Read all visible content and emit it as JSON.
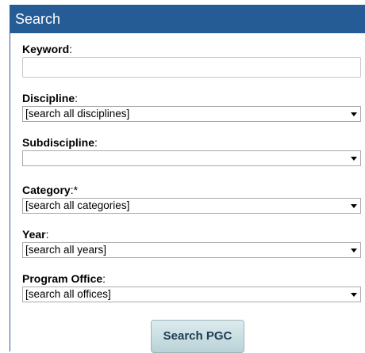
{
  "header": {
    "title": "Search"
  },
  "keyword": {
    "label": "Keyword",
    "colon": ":",
    "value": "",
    "placeholder": ""
  },
  "discipline": {
    "label": "Discipline",
    "colon": ":",
    "selected": "[search all disciplines]"
  },
  "subdiscipline": {
    "label": "Subdiscipline",
    "colon": ":",
    "selected": ""
  },
  "category": {
    "label": "Category",
    "colon": ":*",
    "selected": "[search all categories]"
  },
  "year": {
    "label": "Year",
    "colon": ":",
    "selected": "[search all years]"
  },
  "program_office": {
    "label": "Program Office",
    "colon": ":",
    "selected": "[search all offices]"
  },
  "submit": {
    "label": "Search PGC"
  },
  "colors": {
    "header_bg": "#255c95",
    "button_bg": "#c9dfe3"
  },
  "icons": {
    "dropdown": "chevron-down-icon"
  }
}
